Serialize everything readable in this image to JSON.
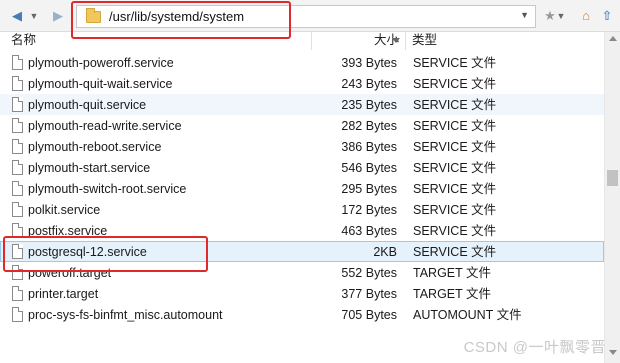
{
  "address": {
    "path": "/usr/lib/systemd/system"
  },
  "columns": {
    "name": "名称",
    "size": "大小",
    "type": "类型"
  },
  "files": [
    {
      "name": "plymouth-poweroff.service",
      "size": "393 Bytes",
      "type": "SERVICE 文件"
    },
    {
      "name": "plymouth-quit-wait.service",
      "size": "243 Bytes",
      "type": "SERVICE 文件"
    },
    {
      "name": "plymouth-quit.service",
      "size": "235 Bytes",
      "type": "SERVICE 文件"
    },
    {
      "name": "plymouth-read-write.service",
      "size": "282 Bytes",
      "type": "SERVICE 文件"
    },
    {
      "name": "plymouth-reboot.service",
      "size": "386 Bytes",
      "type": "SERVICE 文件"
    },
    {
      "name": "plymouth-start.service",
      "size": "546 Bytes",
      "type": "SERVICE 文件"
    },
    {
      "name": "plymouth-switch-root.service",
      "size": "295 Bytes",
      "type": "SERVICE 文件"
    },
    {
      "name": "polkit.service",
      "size": "172 Bytes",
      "type": "SERVICE 文件"
    },
    {
      "name": "postfix.service",
      "size": "463 Bytes",
      "type": "SERVICE 文件"
    },
    {
      "name": "postgresql-12.service",
      "size": "2KB",
      "type": "SERVICE 文件"
    },
    {
      "name": "poweroff.target",
      "size": "552 Bytes",
      "type": "TARGET 文件"
    },
    {
      "name": "printer.target",
      "size": "377 Bytes",
      "type": "TARGET 文件"
    },
    {
      "name": "proc-sys-fs-binfmt_misc.automount",
      "size": "705 Bytes",
      "type": "AUTOMOUNT 文件"
    }
  ],
  "watermark": "CSDN @一叶飘零晋",
  "colors": {
    "highlight": "#e0292b",
    "selected_bg": "#e5f1fb",
    "selected_border": "#99c9ef"
  }
}
